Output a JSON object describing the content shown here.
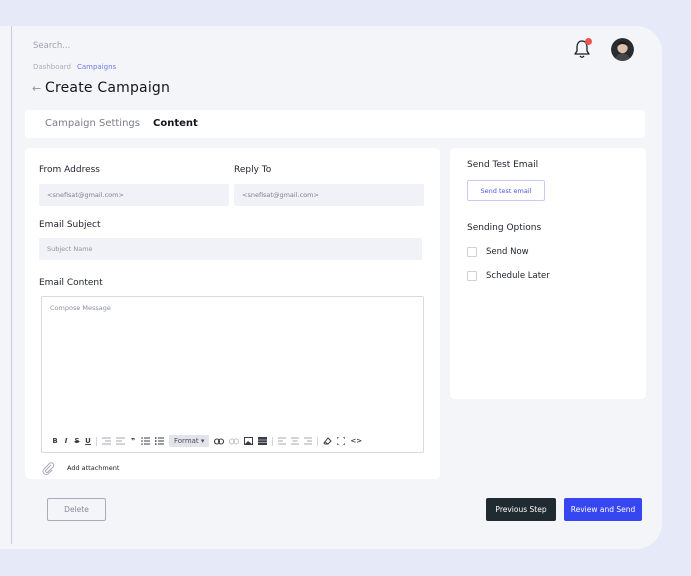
{
  "colors": {
    "accent": "#3646f0",
    "dark": "#1f2a31",
    "badge": "#ef5350",
    "link": "#6f7bf0"
  },
  "header": {
    "search_placeholder": "Search...",
    "bell_icon": "bell-icon",
    "notification_badge": ""
  },
  "breadcrumb": {
    "items": [
      "Dashboard",
      "Campaigns"
    ]
  },
  "page": {
    "back_arrow": "←",
    "title": "Create Campaign"
  },
  "tabs": [
    {
      "label": "Campaign Settings",
      "active": false
    },
    {
      "label": "Content",
      "active": true
    }
  ],
  "form": {
    "from_address": {
      "label": "From Address",
      "value": "<snefisat@gmail.com>"
    },
    "reply_to": {
      "label": "Reply To",
      "value": "<snefisat@gmail.com>"
    },
    "subject": {
      "label": "Email Subject",
      "placeholder": "Subject Name"
    },
    "content": {
      "label": "Email Content",
      "placeholder": "Compose Message"
    },
    "toolbar": {
      "bold": "B",
      "italic": "I",
      "strike": "S",
      "underline": "U",
      "quote": "❞",
      "format": "Format ▾",
      "code": "<>"
    },
    "attachment": {
      "label": "Add attachment",
      "icon": "paperclip-icon"
    }
  },
  "sidebar": {
    "test_email": {
      "title": "Send Test Email",
      "button": "Send test email"
    },
    "sending_options": {
      "title": "Sending Options",
      "options": [
        {
          "label": "Send Now",
          "checked": false
        },
        {
          "label": "Schedule Later",
          "checked": false
        }
      ]
    }
  },
  "footer": {
    "delete": "Delete",
    "previous": "Previous Step",
    "review": "Review and Send"
  }
}
